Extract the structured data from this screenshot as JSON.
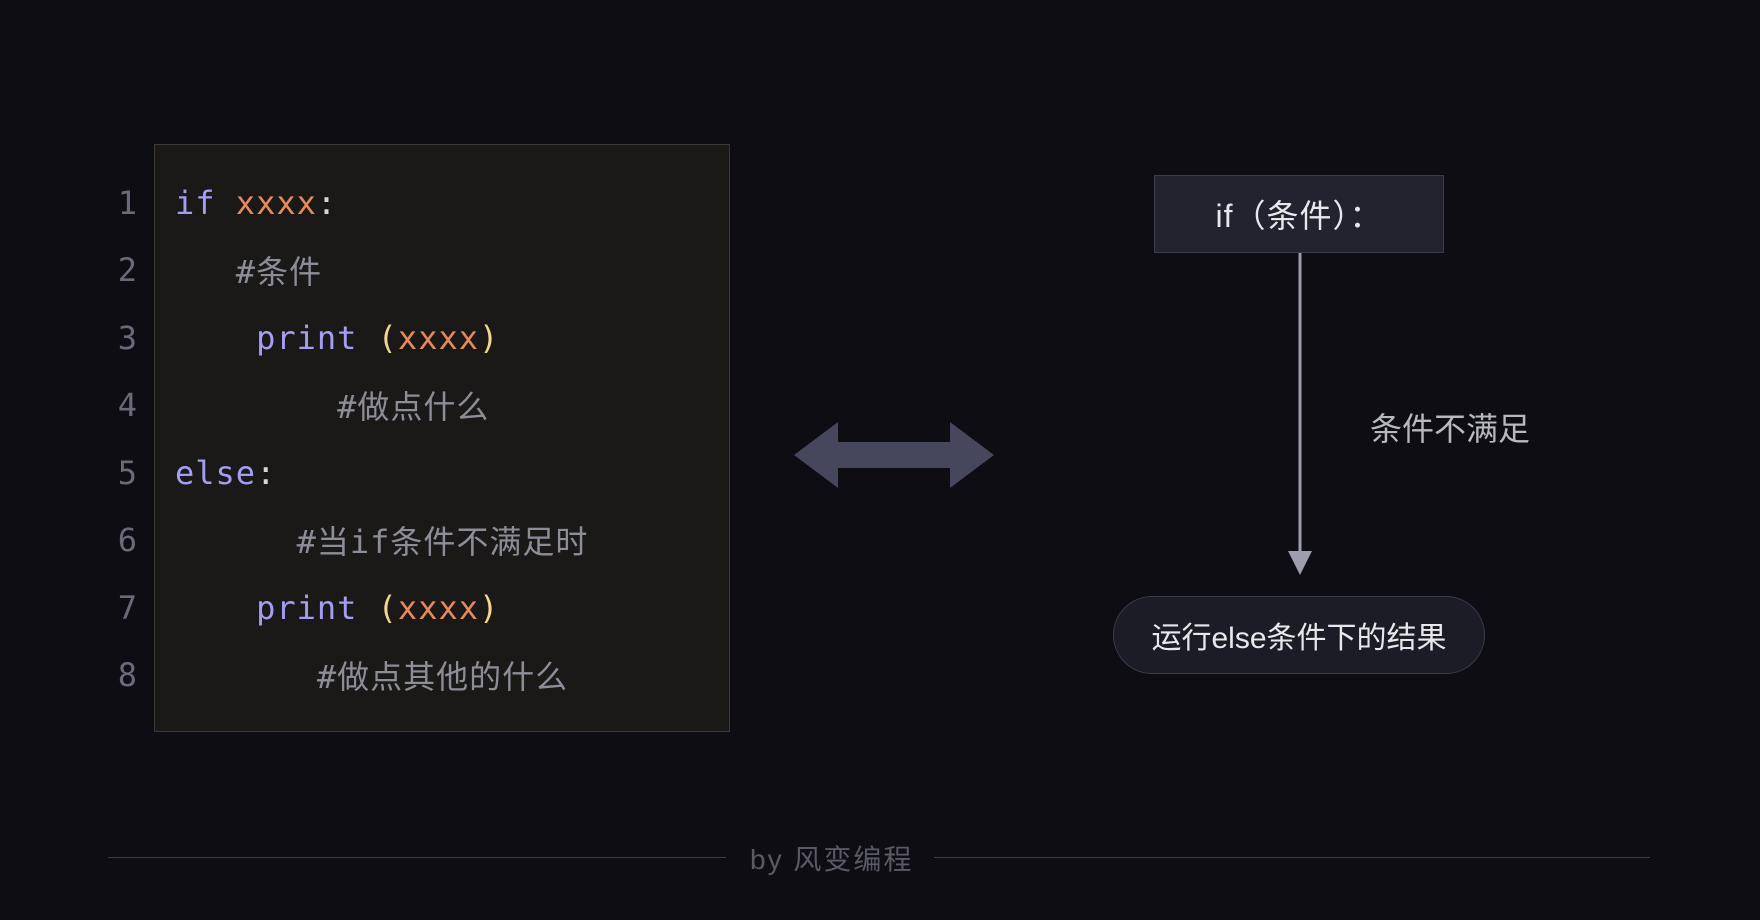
{
  "code": {
    "lines": [
      {
        "n": "1",
        "indent": "",
        "segments": [
          {
            "cls": "tok-keyword",
            "text": "if "
          },
          {
            "cls": "tok-arg",
            "text": "xxxx"
          },
          {
            "cls": "tok-punct",
            "text": ":"
          }
        ]
      },
      {
        "n": "2",
        "indent": "   ",
        "segments": [
          {
            "cls": "tok-comment",
            "text": "#条件"
          }
        ]
      },
      {
        "n": "3",
        "indent": "    ",
        "segments": [
          {
            "cls": "tok-func",
            "text": "print "
          },
          {
            "cls": "tok-paren",
            "text": "("
          },
          {
            "cls": "tok-arg",
            "text": "xxxx"
          },
          {
            "cls": "tok-paren",
            "text": ")"
          }
        ]
      },
      {
        "n": "4",
        "indent": "        ",
        "segments": [
          {
            "cls": "tok-comment",
            "text": "#做点什么"
          }
        ]
      },
      {
        "n": "5",
        "indent": "",
        "segments": [
          {
            "cls": "tok-keyword",
            "text": "else"
          },
          {
            "cls": "tok-punct",
            "text": ":"
          }
        ]
      },
      {
        "n": "6",
        "indent": "      ",
        "segments": [
          {
            "cls": "tok-comment",
            "text": "#当if条件不满足时"
          }
        ]
      },
      {
        "n": "7",
        "indent": "    ",
        "segments": [
          {
            "cls": "tok-func",
            "text": "print "
          },
          {
            "cls": "tok-paren",
            "text": "("
          },
          {
            "cls": "tok-arg",
            "text": "xxxx"
          },
          {
            "cls": "tok-paren",
            "text": ")"
          }
        ]
      },
      {
        "n": "8",
        "indent": "       ",
        "segments": [
          {
            "cls": "tok-comment",
            "text": "#做点其他的什么"
          }
        ]
      }
    ]
  },
  "flow": {
    "if_box": "if（条件）：",
    "arrow_label": "条件不满足",
    "else_box": "运行else条件下的结果"
  },
  "footer": "by 风变编程"
}
